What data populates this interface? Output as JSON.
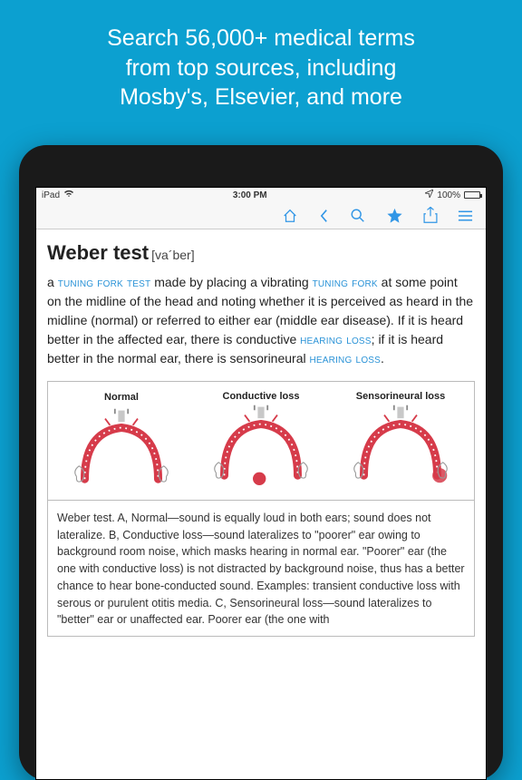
{
  "promo": {
    "line1": "Search 56,000+ medical terms",
    "line2": "from top sources, including",
    "line3": "Mosby's, Elsevier, and more"
  },
  "status": {
    "carrier": "iPad",
    "wifi": "wifi",
    "time": "3:00 PM",
    "battery_pct": "100%"
  },
  "entry": {
    "term": "Weber test",
    "pronunciation": "[va´ber]",
    "def_prefix": "a ",
    "link1": "tuning fork test",
    "def_mid1": " made by placing a vibrating ",
    "link2": "tuning fork",
    "def_mid2": " at some point on the midline of the head and noting whether it is perceived as heard in the midline (normal) or referred to either ear (middle ear disease). If it is heard better in the affected ear, there is conductive ",
    "link3": "hearing loss",
    "def_mid3": "; if it is heard better in the normal ear, there is sensorineural ",
    "link4": "hearing loss",
    "def_suffix": "."
  },
  "diagrams": {
    "a": "Normal",
    "b": "Conductive loss",
    "c": "Sensorineural loss"
  },
  "caption": "Weber test. A, Normal—sound is equally loud in both ears; sound does not lateralize. B, Conductive loss—sound lateralizes to \"poorer\" ear owing to background room noise, which masks hearing in normal ear. \"Poorer\" ear (the one with conductive loss) is not distracted by background noise, thus has a better chance to hear bone-conducted sound. Examples: transient conductive loss with serous or purulent otitis media. C, Sensorineural loss—sound lateralizes to \"better\" ear or unaffected ear. Poorer ear (the one with"
}
